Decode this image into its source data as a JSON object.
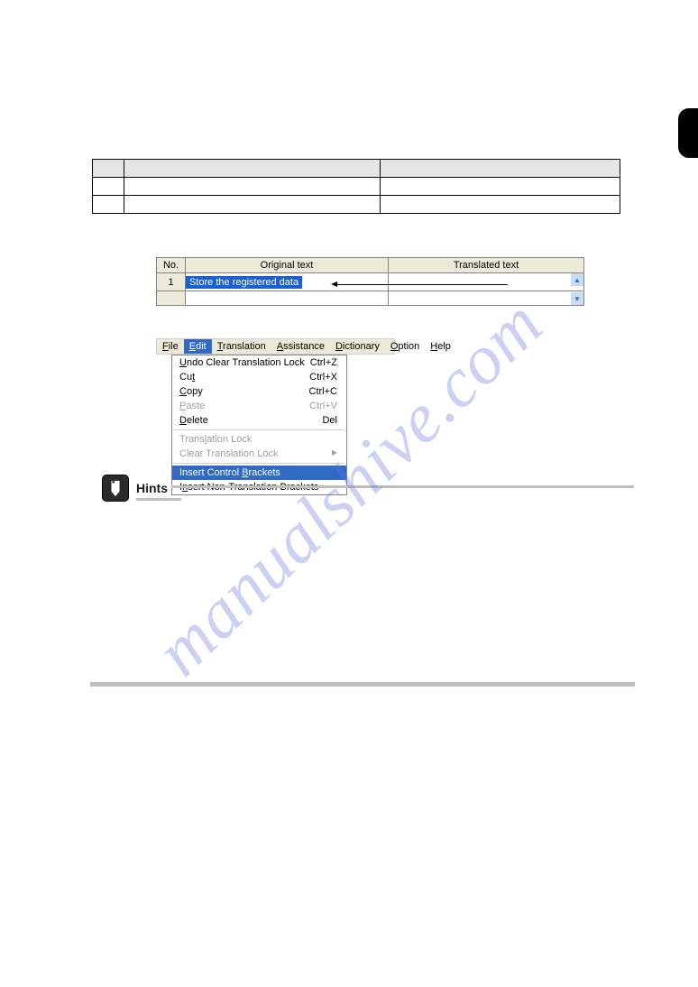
{
  "page": {
    "watermark": "manualshive.com",
    "hints_label": "Hints"
  },
  "grid": {
    "headers": {
      "no": "No.",
      "original": "Original text",
      "translated": "Translated text"
    },
    "row": {
      "no": "1",
      "text": "Store the registered data"
    }
  },
  "menubar": {
    "items": [
      {
        "label": "File",
        "accel": "F"
      },
      {
        "label": "Edit",
        "accel": "E",
        "active": true
      },
      {
        "label": "Translation",
        "accel": "T"
      },
      {
        "label": "Assistance",
        "accel": "A"
      },
      {
        "label": "Dictionary",
        "accel": "D"
      },
      {
        "label": "Option",
        "accel": "O"
      },
      {
        "label": "Help",
        "accel": "H"
      }
    ]
  },
  "dropdown": {
    "items": [
      {
        "label": "Undo Clear Translation Lock",
        "shortcut": "Ctrl+Z",
        "accel": "U"
      },
      {
        "label": "Cut",
        "shortcut": "Ctrl+X",
        "accel": "t"
      },
      {
        "label": "Copy",
        "shortcut": "Ctrl+C",
        "accel": "C"
      },
      {
        "label": "Paste",
        "shortcut": "Ctrl+V",
        "accel": "P",
        "disabled": true
      },
      {
        "label": "Delete",
        "shortcut": "Del",
        "accel": "D"
      },
      {
        "sep": true
      },
      {
        "label": "Translation Lock",
        "accel": "L",
        "disabled": true
      },
      {
        "label": "Clear Translation Lock",
        "submenu": true,
        "disabled": true
      },
      {
        "sep": true
      },
      {
        "label": "Insert Control Brackets",
        "accel": "B",
        "selected": true
      },
      {
        "label": "Insert Non-Translation Brackets",
        "accel": "N"
      }
    ]
  }
}
